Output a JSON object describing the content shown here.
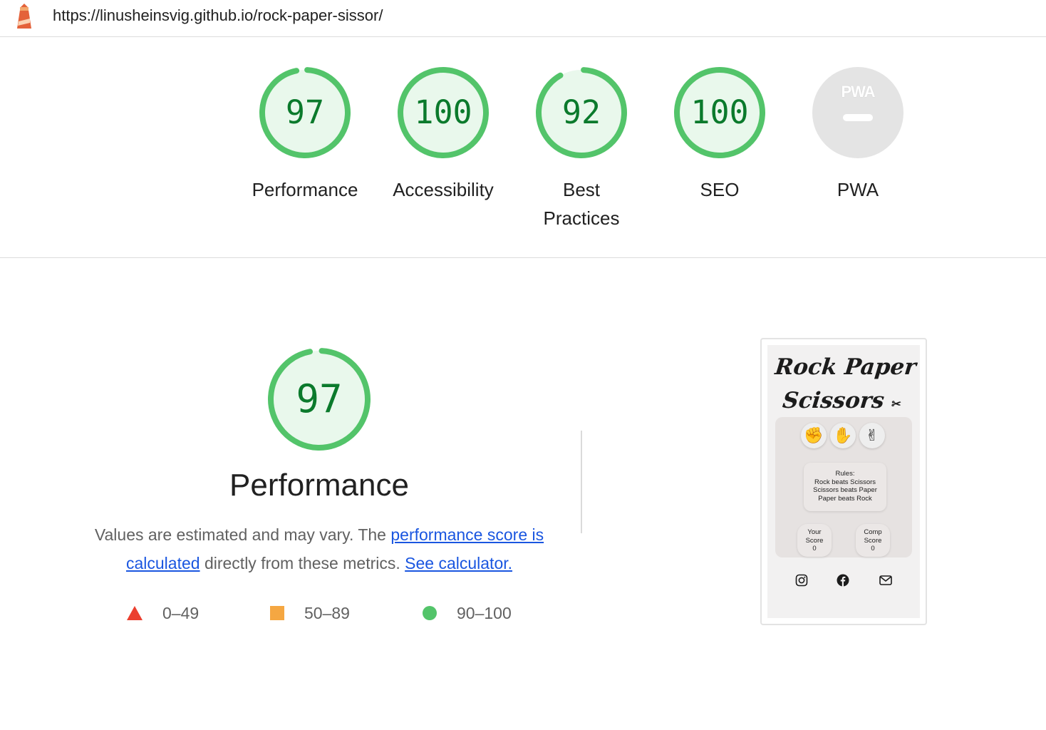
{
  "header": {
    "url": "https://linusheinsvig.github.io/rock-paper-sissor/",
    "logo_icon": "lighthouse-icon"
  },
  "summary": [
    {
      "id": "performance",
      "score": "97",
      "score_value": 97,
      "label": "Performance"
    },
    {
      "id": "accessibility",
      "score": "100",
      "score_value": 100,
      "label": "Accessibility"
    },
    {
      "id": "best-practices",
      "score": "92",
      "score_value": 92,
      "label_line1": "Best",
      "label_line2": "Practices"
    },
    {
      "id": "seo",
      "score": "100",
      "score_value": 100,
      "label": "SEO"
    },
    {
      "id": "pwa",
      "badge_text": "PWA",
      "label": "PWA"
    }
  ],
  "performance_section": {
    "score": "97",
    "score_value": 97,
    "title": "Performance",
    "desc_prefix": "Values are estimated and may vary. The ",
    "link_score": "performance score is calculated",
    "desc_middle": " directly from these metrics. ",
    "link_calculator": "See calculator.",
    "legend": [
      {
        "icon": "triangle-fail-icon",
        "range": "0–49"
      },
      {
        "icon": "square-average-icon",
        "range": "50–89"
      },
      {
        "icon": "circle-pass-icon",
        "range": "90–100"
      }
    ]
  },
  "screenshot": {
    "title_line1": "Rock Paper",
    "title_line2": "Scissors",
    "title_emoji": "✂",
    "hands": [
      "rock-hand-icon",
      "paper-hand-icon",
      "scissors-hand-icon"
    ],
    "rules": [
      "Rules:",
      "Rock beats Scissors",
      "Scissors beats Paper",
      "Paper beats Rock"
    ],
    "your_score": {
      "line1": "Your",
      "line2": "Score",
      "value": "0"
    },
    "comp_score": {
      "line1": "Comp",
      "line2": "Score",
      "value": "0"
    },
    "social_icons": [
      "instagram-icon",
      "facebook-icon",
      "mail-icon"
    ]
  },
  "colors": {
    "pass_green": "#0b7a2c",
    "pass_ring": "#53c46a",
    "pass_fill": "#e9f8ec",
    "fail_red": "#eb3f2f",
    "average_orange": "#f5a742",
    "link_blue": "#1a56e0"
  }
}
